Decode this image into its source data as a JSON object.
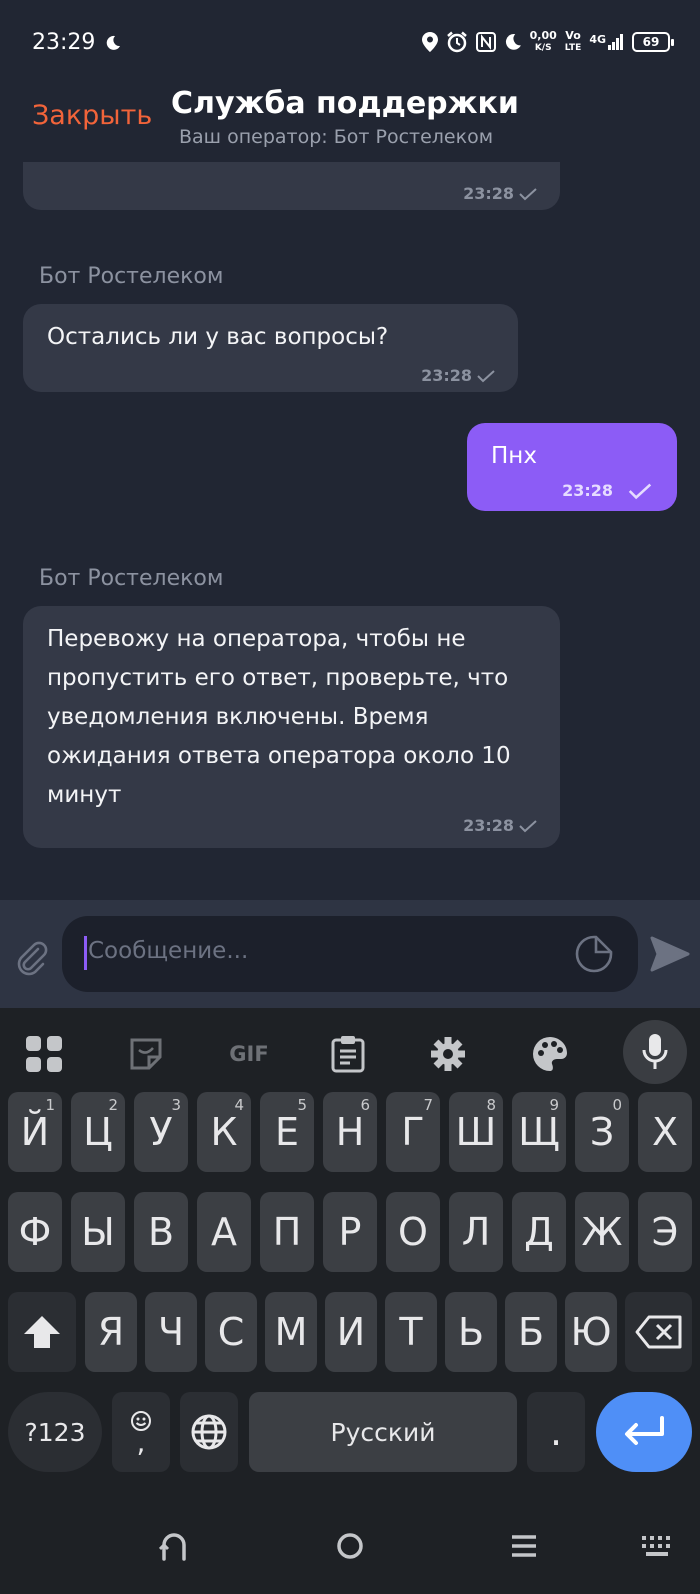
{
  "status_bar": {
    "time": "23:29",
    "net_speed_value": "0,00",
    "net_speed_unit": "K/S",
    "volte_top": "Vo",
    "volte_bottom": "LTE",
    "network": "4G",
    "battery": "69"
  },
  "header": {
    "close_label": "Закрыть",
    "title": "Служба поддержки",
    "subtitle": "Ваш оператор: Бот Ростелеком"
  },
  "messages": [
    {
      "sender": "",
      "text": "",
      "time": "23:28",
      "outgoing": false
    },
    {
      "sender": "Бот Ростелеком",
      "text": "Остались ли у вас вопросы?",
      "time": "23:28",
      "outgoing": false
    },
    {
      "sender": "",
      "text": "Пнх",
      "time": "23:28",
      "outgoing": true
    },
    {
      "sender": "Бот Ростелеком",
      "text_lines": [
        "Перевожу на оператора, чтобы не",
        "пропустить его ответ, проверьте, что",
        "уведомления включены. Время",
        "ожидания ответа оператора около 10",
        "минут"
      ],
      "time": "23:28",
      "outgoing": false
    }
  ],
  "input": {
    "placeholder": "Сообщение..."
  },
  "keyboard": {
    "toolbar": [
      "apps-icon",
      "sticker-icon",
      "GIF",
      "clipboard-icon",
      "gear-icon",
      "palette-icon",
      "mic-icon"
    ],
    "row1": [
      {
        "k": "Й",
        "n": "1"
      },
      {
        "k": "Ц",
        "n": "2"
      },
      {
        "k": "У",
        "n": "3"
      },
      {
        "k": "К",
        "n": "4"
      },
      {
        "k": "Е",
        "n": "5"
      },
      {
        "k": "Н",
        "n": "6"
      },
      {
        "k": "Г",
        "n": "7"
      },
      {
        "k": "Ш",
        "n": "8"
      },
      {
        "k": "Щ",
        "n": "9"
      },
      {
        "k": "З",
        "n": "0"
      },
      {
        "k": "Х",
        "n": ""
      }
    ],
    "row2": [
      "Ф",
      "Ы",
      "В",
      "А",
      "П",
      "Р",
      "О",
      "Л",
      "Д",
      "Ж",
      "Э"
    ],
    "row3": [
      "Я",
      "Ч",
      "С",
      "М",
      "И",
      "Т",
      "Ь",
      "Б",
      "Ю"
    ],
    "row4": {
      "symbols": "?123",
      "comma": ",",
      "space": "Русский",
      "period": "."
    }
  },
  "colors": {
    "background": "#212633",
    "accent_close": "#f2643a",
    "outgoing_bubble": "#8c5cf6",
    "incoming_bubble": "#343947",
    "enter_key": "#4f8ff7"
  }
}
